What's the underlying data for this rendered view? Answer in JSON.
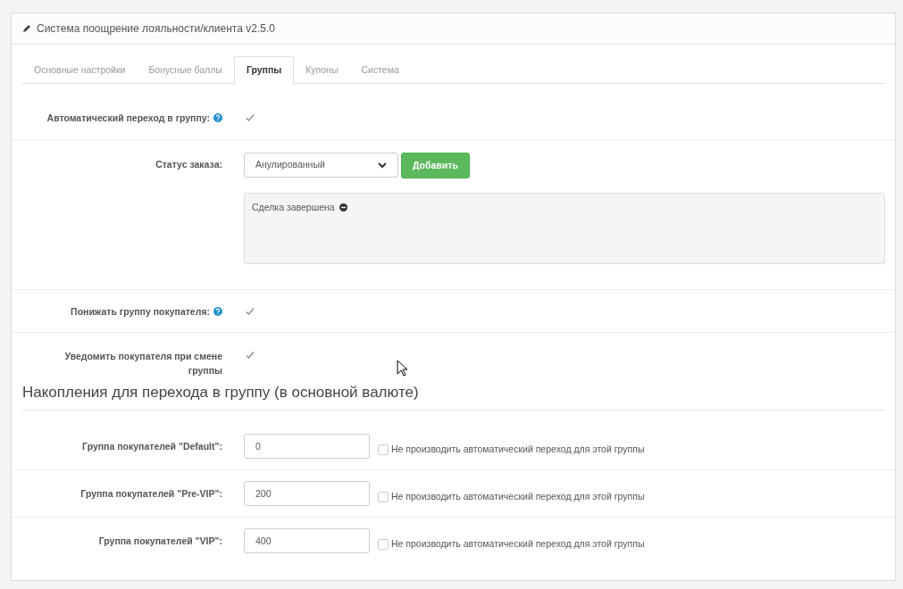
{
  "panel": {
    "title": "Система поощрение лояльности/клиента v2.5.0"
  },
  "tabs": [
    {
      "label": "Основные настройки",
      "selected": false
    },
    {
      "label": "Бонусные баллы",
      "selected": false
    },
    {
      "label": "Группы",
      "selected": true
    },
    {
      "label": "Купоны",
      "selected": false
    },
    {
      "label": "Система",
      "selected": false
    }
  ],
  "auto_transition": {
    "label": "Автоматический переход в группу:",
    "help": true,
    "checked": true
  },
  "order_status": {
    "label": "Статус заказа:",
    "select_value": "Анулированный",
    "button": "Добавить",
    "items": [
      "Сделка завершена"
    ]
  },
  "downgrade": {
    "label": "Понижать группу покупателя:",
    "help": true,
    "checked": true
  },
  "notify": {
    "label": "Уведомить покупателя при смене группы",
    "help": false,
    "checked": true
  },
  "accumulation": {
    "heading": "Накопления для перехода в группу (в основной валюте)",
    "rows": [
      {
        "label": "Группа покупателей \"Default\":",
        "value": "0",
        "checkbox_label": "Не производить автоматический переход для этой группы",
        "checked": false
      },
      {
        "label": "Группа покупателей \"Pre-VIP\":",
        "value": "200",
        "checkbox_label": "Не производить автоматический переход для этой группы",
        "checked": false
      },
      {
        "label": "Группа покупателей \"VIP\":",
        "value": "400",
        "checkbox_label": "Не производить автоматический переход для этой группы",
        "checked": false
      }
    ]
  }
}
